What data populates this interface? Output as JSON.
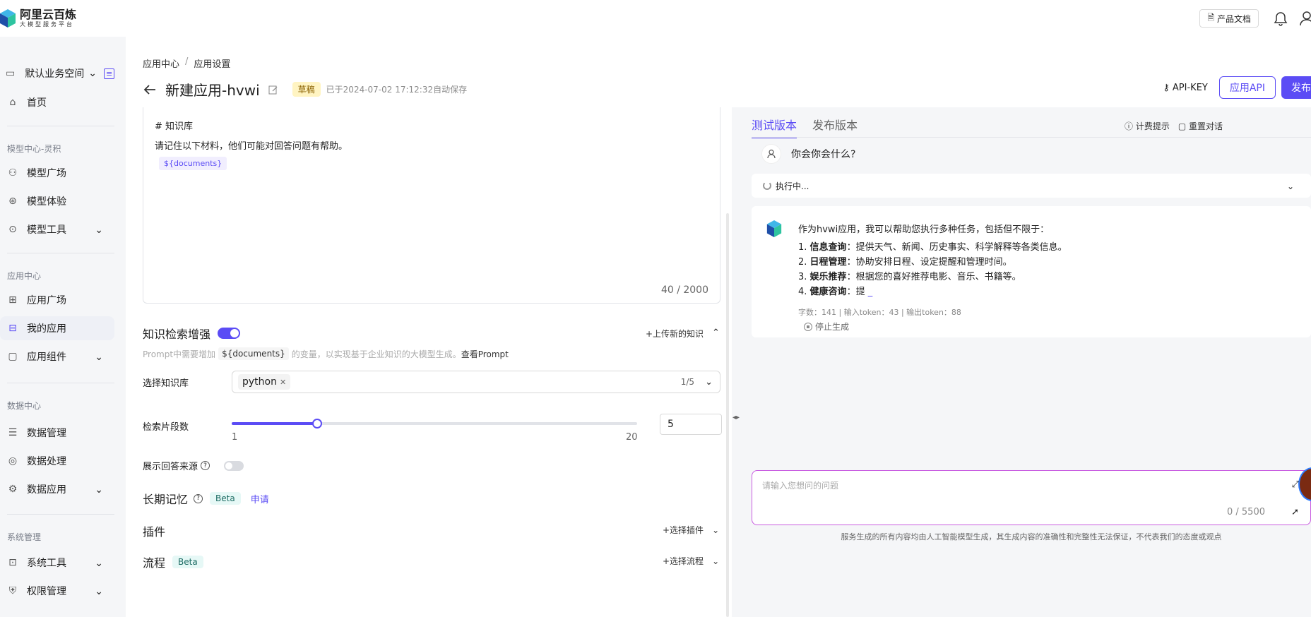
{
  "header": {
    "logo_title": "阿里云百炼",
    "logo_subtitle": "大模型服务平台",
    "doc_button": "产品文档",
    "icons": [
      "bell-icon",
      "user-icon"
    ]
  },
  "sidebar": {
    "workspace": "默认业务空间",
    "home": "首页",
    "sections": {
      "model": "模型中心-灵积",
      "app": "应用中心",
      "data": "数据中心",
      "system": "系统管理"
    },
    "items": {
      "model_plaza": "模型广场",
      "model_experience": "模型体验",
      "model_tools": "模型工具",
      "app_plaza": "应用广场",
      "my_apps": "我的应用",
      "app_components": "应用组件",
      "data_manage": "数据管理",
      "data_process": "数据处理",
      "data_apps": "数据应用",
      "system_tools": "系统工具",
      "permission": "权限管理"
    },
    "active": "my_apps"
  },
  "page": {
    "breadcrumb": [
      "应用中心",
      "/",
      "应用设置"
    ],
    "title": "新建应用-hvwi",
    "status_badge": "草稿",
    "saved_text": "已于2024-07-02 17:12:32自动保存",
    "api_key": "API-KEY",
    "app_api": "应用API",
    "publish": "发布"
  },
  "prompt": {
    "heading": "# 知识库",
    "text": "请记住以下材料，他们可能对回答问题有帮助。",
    "variable": "${documents}",
    "counter": "40 / 2000"
  },
  "knowledge": {
    "title": "知识检索增强",
    "enabled": true,
    "upload_link": "+上传新的知识",
    "hint_prefix": "Prompt中需要增加",
    "hint_var": "${documents}",
    "hint_suffix": "的变量，以实现基于企业知识的大模型生成。",
    "hint_link": "查看Prompt",
    "select_label": "选择知识库",
    "selected_chip": "python",
    "selected_count": "1/5",
    "segments_label": "检索片段数",
    "segments_min": "1",
    "segments_max": "20",
    "segments_value": "5",
    "slider_fraction": 0.21,
    "show_source_label": "展示回答来源",
    "show_source_enabled": false
  },
  "memory": {
    "title": "长期记忆",
    "badge": "Beta",
    "apply": "申请"
  },
  "plugins": {
    "title": "插件",
    "add": "+选择插件"
  },
  "flow": {
    "title": "流程",
    "badge": "Beta",
    "add": "+选择流程"
  },
  "test_panel": {
    "tabs": [
      "测试版本",
      "发布版本"
    ],
    "active_tab": 0,
    "billing_tip": "计费提示",
    "reset_chat": "重置对话",
    "user_question": "你会你会什么?",
    "exec_status": "执行中...",
    "answer_intro": "作为hvwi应用，我可以帮助您执行多种任务，包括但不限于：",
    "answer_items": [
      {
        "num": "1.",
        "bold": "信息查询",
        "text": "：提供天气、新闻、历史事实、科学解释等各类信息。"
      },
      {
        "num": "2.",
        "bold": "日程管理",
        "text": "：协助安排日程、设定提醒和管理时间。"
      },
      {
        "num": "3.",
        "bold": "娱乐推荐",
        "text": "：根据您的喜好推荐电影、音乐、书籍等。"
      },
      {
        "num": "4.",
        "bold": "健康咨询",
        "text": "：提"
      }
    ],
    "answer_meta": "字数：141  |   输入token：43  |   输出token：88",
    "stop": "停止生成",
    "input_placeholder": "请输入您想问的问题",
    "input_counter": "0 / 5500",
    "disclaimer": "服务生成的所有内容均由人工智能模型生成，其生成内容的准确性和完整性无法保证，不代表我们的态度或观点"
  },
  "colors": {
    "accent": "#5b4cf5",
    "draft_bg": "#fff4c2",
    "beta_bg": "#e6f8f6"
  }
}
